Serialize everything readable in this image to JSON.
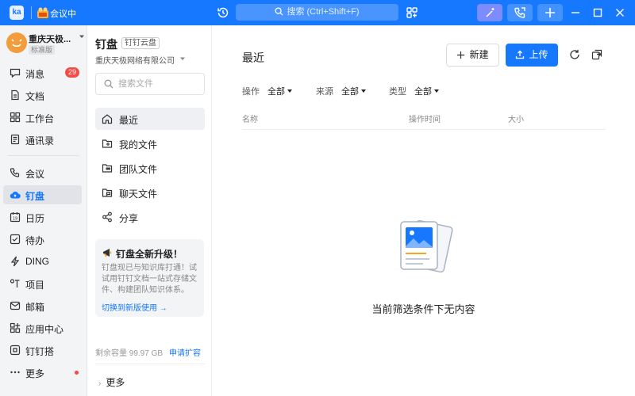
{
  "titlebar": {
    "logo": "ka",
    "meeting_label": "会议中",
    "search_placeholder": "搜索 (Ctrl+Shift+F)"
  },
  "org": {
    "name": "重庆天极...",
    "tag": "标准版"
  },
  "nav": {
    "items": [
      {
        "label": "消息",
        "icon": "message-icon",
        "badge": "29"
      },
      {
        "label": "文档",
        "icon": "document-icon"
      },
      {
        "label": "工作台",
        "icon": "workbench-icon"
      },
      {
        "label": "通讯录",
        "icon": "contacts-icon"
      },
      {
        "label": "会议",
        "icon": "meeting-icon"
      },
      {
        "label": "钉盘",
        "icon": "cloud-drive-icon",
        "active": true
      },
      {
        "label": "日历",
        "icon": "calendar-icon"
      },
      {
        "label": "待办",
        "icon": "todo-icon"
      },
      {
        "label": "DING",
        "icon": "ding-icon"
      },
      {
        "label": "项目",
        "icon": "project-icon"
      },
      {
        "label": "邮箱",
        "icon": "mail-icon"
      },
      {
        "label": "应用中心",
        "icon": "app-center-icon"
      },
      {
        "label": "钉钉搭",
        "icon": "builder-icon"
      },
      {
        "label": "更多",
        "icon": "more-icon",
        "dot": true
      }
    ]
  },
  "side": {
    "title": "钉盘",
    "tag": "钉钉云盘",
    "org": "重庆天极网络有限公司",
    "search_placeholder": "搜索文件",
    "items": [
      {
        "label": "最近",
        "icon": "home-icon",
        "active": true
      },
      {
        "label": "我的文件",
        "icon": "my-files-folder-icon"
      },
      {
        "label": "团队文件",
        "icon": "team-files-folder-icon"
      },
      {
        "label": "聊天文件",
        "icon": "chat-files-folder-icon"
      },
      {
        "label": "分享",
        "icon": "share-icon"
      }
    ],
    "promo": {
      "title": "钉盘全新升级！",
      "text": "钉盘现已与知识库打通！试试用钉钉文档一站式存储文件、构建团队知识体系。",
      "link": "切换到新版使用 →"
    },
    "storage_label": "剩余容量 99.97 GB",
    "storage_link": "申请扩容",
    "more_label": "更多"
  },
  "main": {
    "title": "最近",
    "new_button": "新建",
    "upload_button": "上传",
    "filters": [
      {
        "label": "操作",
        "value": "全部"
      },
      {
        "label": "来源",
        "value": "全部"
      },
      {
        "label": "类型",
        "value": "全部"
      }
    ],
    "columns": {
      "name": "名称",
      "time": "操作时间",
      "size": "大小"
    },
    "empty_text": "当前筛选条件下无内容"
  },
  "colors": {
    "brand_blue": "#1677ff",
    "badge_red": "#f54a45",
    "nav_bg": "#f3f4f6"
  }
}
